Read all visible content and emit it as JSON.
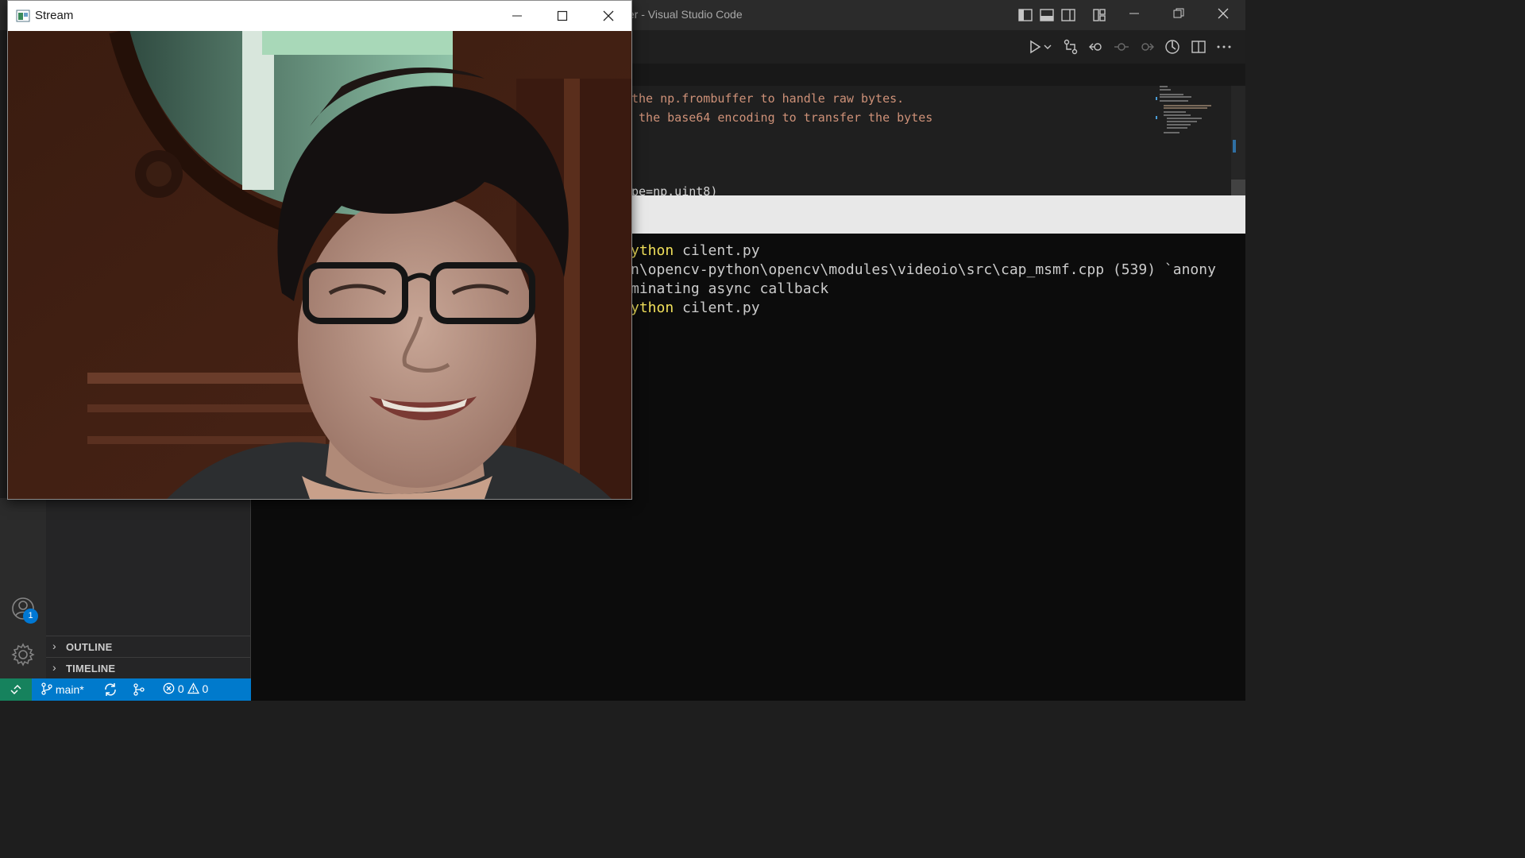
{
  "vscode": {
    "window_title": "sfer - Visual Studio Code",
    "editor_lines": [
      "the np.frombuffer to handle raw bytes.",
      " the base64 encoding to transfer the bytes",
      "pe=np.uint8)"
    ],
    "terminal_lines": [
      {
        "prefix": "ython",
        "rest": " cilent.py"
      },
      {
        "prefix": "",
        "rest": "n\\opencv-python\\opencv\\modules\\videoio\\src\\cap_msmf.cpp (539) `anony"
      },
      {
        "prefix": "",
        "rest": "minating async callback"
      },
      {
        "prefix": "ython",
        "rest": " cilent.py"
      }
    ],
    "sidebar_sections": [
      "OUTLINE",
      "TIMELINE"
    ],
    "accounts_badge": "1",
    "status": {
      "branch": "main*",
      "errors": "0",
      "warnings": "0"
    }
  },
  "stream_window": {
    "title": "Stream"
  },
  "colors": {
    "statusbar": "#007acc",
    "remote": "#16825d",
    "terminal_bg": "#0c0c0c",
    "string": "#ce9178"
  }
}
